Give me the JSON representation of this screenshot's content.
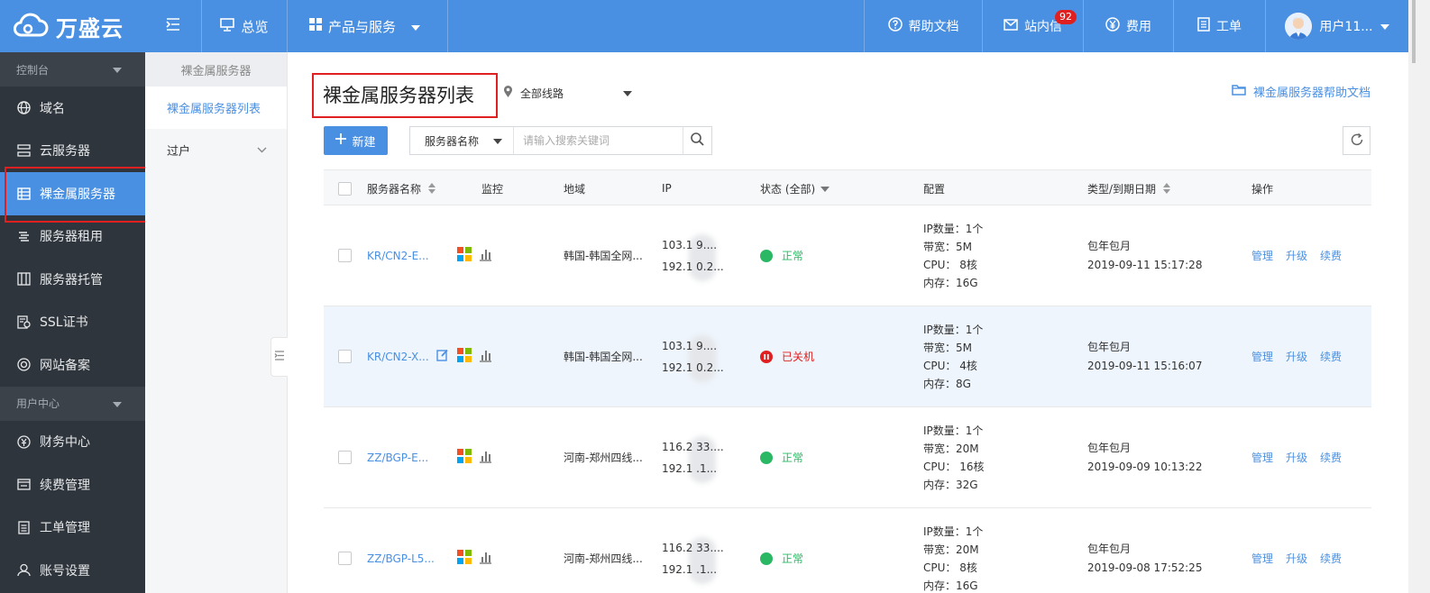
{
  "brand": {
    "name": "万盛云"
  },
  "topnav": {
    "overview": "总览",
    "products": "产品与服务",
    "help_docs": "帮助文档",
    "messages": "站内信",
    "messages_badge": "92",
    "billing": "费用",
    "tickets": "工单",
    "user": "用户11..."
  },
  "sidebar": {
    "group_console": "控制台",
    "items_console": [
      {
        "label": "域名",
        "icon": "globe-icon"
      },
      {
        "label": "云服务器",
        "icon": "server-icon"
      },
      {
        "label": "裸金属服务器",
        "icon": "baremetal-icon",
        "active": true
      },
      {
        "label": "服务器租用",
        "icon": "rent-icon"
      },
      {
        "label": "服务器托管",
        "icon": "hosting-icon"
      },
      {
        "label": "SSL证书",
        "icon": "certificate-icon"
      },
      {
        "label": "网站备案",
        "icon": "record-icon"
      }
    ],
    "group_user": "用户中心",
    "items_user": [
      {
        "label": "财务中心",
        "icon": "finance-icon"
      },
      {
        "label": "续费管理",
        "icon": "renewal-icon"
      },
      {
        "label": "工单管理",
        "icon": "ticket-icon"
      },
      {
        "label": "账号设置",
        "icon": "account-icon"
      }
    ]
  },
  "subnav": {
    "title": "裸金属服务器",
    "items": [
      {
        "label": "裸金属服务器列表",
        "active": true
      },
      {
        "label": "过户"
      }
    ]
  },
  "main": {
    "title": "裸金属服务器列表",
    "region": "全部线路",
    "help_link": "裸金属服务器帮助文档",
    "new_button": "新建",
    "search_field": "服务器名称",
    "search_placeholder": "请输入搜索关键词"
  },
  "table": {
    "headers": {
      "name": "服务器名称",
      "monitor": "监控",
      "region": "地域",
      "ip": "IP",
      "status": "状态 (全部)",
      "config": "配置",
      "type": "类型/到期日期",
      "ops": "操作"
    },
    "rows": [
      {
        "name": "KR/CN2-E...",
        "region": "韩国-韩国全网...",
        "ip1": "103.1     9....",
        "ip2": "192.1     0.2...",
        "status": "正常",
        "status_color": "#2ab865",
        "cfg_ip": "IP数量：1个",
        "cfg_bw": "带宽：5M",
        "cfg_cpu": "CPU： 8核",
        "cfg_mem": "内存：16G",
        "type": "包年包月",
        "expire": "2019-09-11 15:17:28",
        "op_manage": "管理",
        "op_upgrade": "升级",
        "op_renew": "续费"
      },
      {
        "name": "KR/CN2-X...",
        "region": "韩国-韩国全网...",
        "ip1": "103.1     9....",
        "ip2": "192.1     0.2...",
        "status": "已关机",
        "status_color": "#e02020",
        "cfg_ip": "IP数量：1个",
        "cfg_bw": "带宽：5M",
        "cfg_cpu": "CPU： 4核",
        "cfg_mem": "内存：8G",
        "type": "包年包月",
        "expire": "2019-09-11 15:16:07",
        "op_manage": "管理",
        "op_upgrade": "升级",
        "op_renew": "续费"
      },
      {
        "name": "ZZ/BGP-E...",
        "region": "河南-郑州四线...",
        "ip1": "116.2     33....",
        "ip2": "192.1     .1...",
        "status": "正常",
        "status_color": "#2ab865",
        "cfg_ip": "IP数量：1个",
        "cfg_bw": "带宽：20M",
        "cfg_cpu": "CPU： 16核",
        "cfg_mem": "内存：32G",
        "type": "包年包月",
        "expire": "2019-09-09 10:13:22",
        "op_manage": "管理",
        "op_upgrade": "升级",
        "op_renew": "续费"
      },
      {
        "name": "ZZ/BGP-L5...",
        "region": "河南-郑州四线...",
        "ip1": "116.2     33....",
        "ip2": "192.1     .1...",
        "status": "正常",
        "status_color": "#2ab865",
        "cfg_ip": "IP数量：1个",
        "cfg_bw": "带宽：20M",
        "cfg_cpu": "CPU： 8核",
        "cfg_mem": "内存：16G",
        "type": "包年包月",
        "expire": "2019-09-08 17:52:25",
        "op_manage": "管理",
        "op_upgrade": "升级",
        "op_renew": "续费"
      }
    ]
  },
  "colors": {
    "accent": "#4a90e2",
    "sidebar_bg": "#2f353c",
    "ok": "#2ab865",
    "stopped": "#e02020"
  }
}
